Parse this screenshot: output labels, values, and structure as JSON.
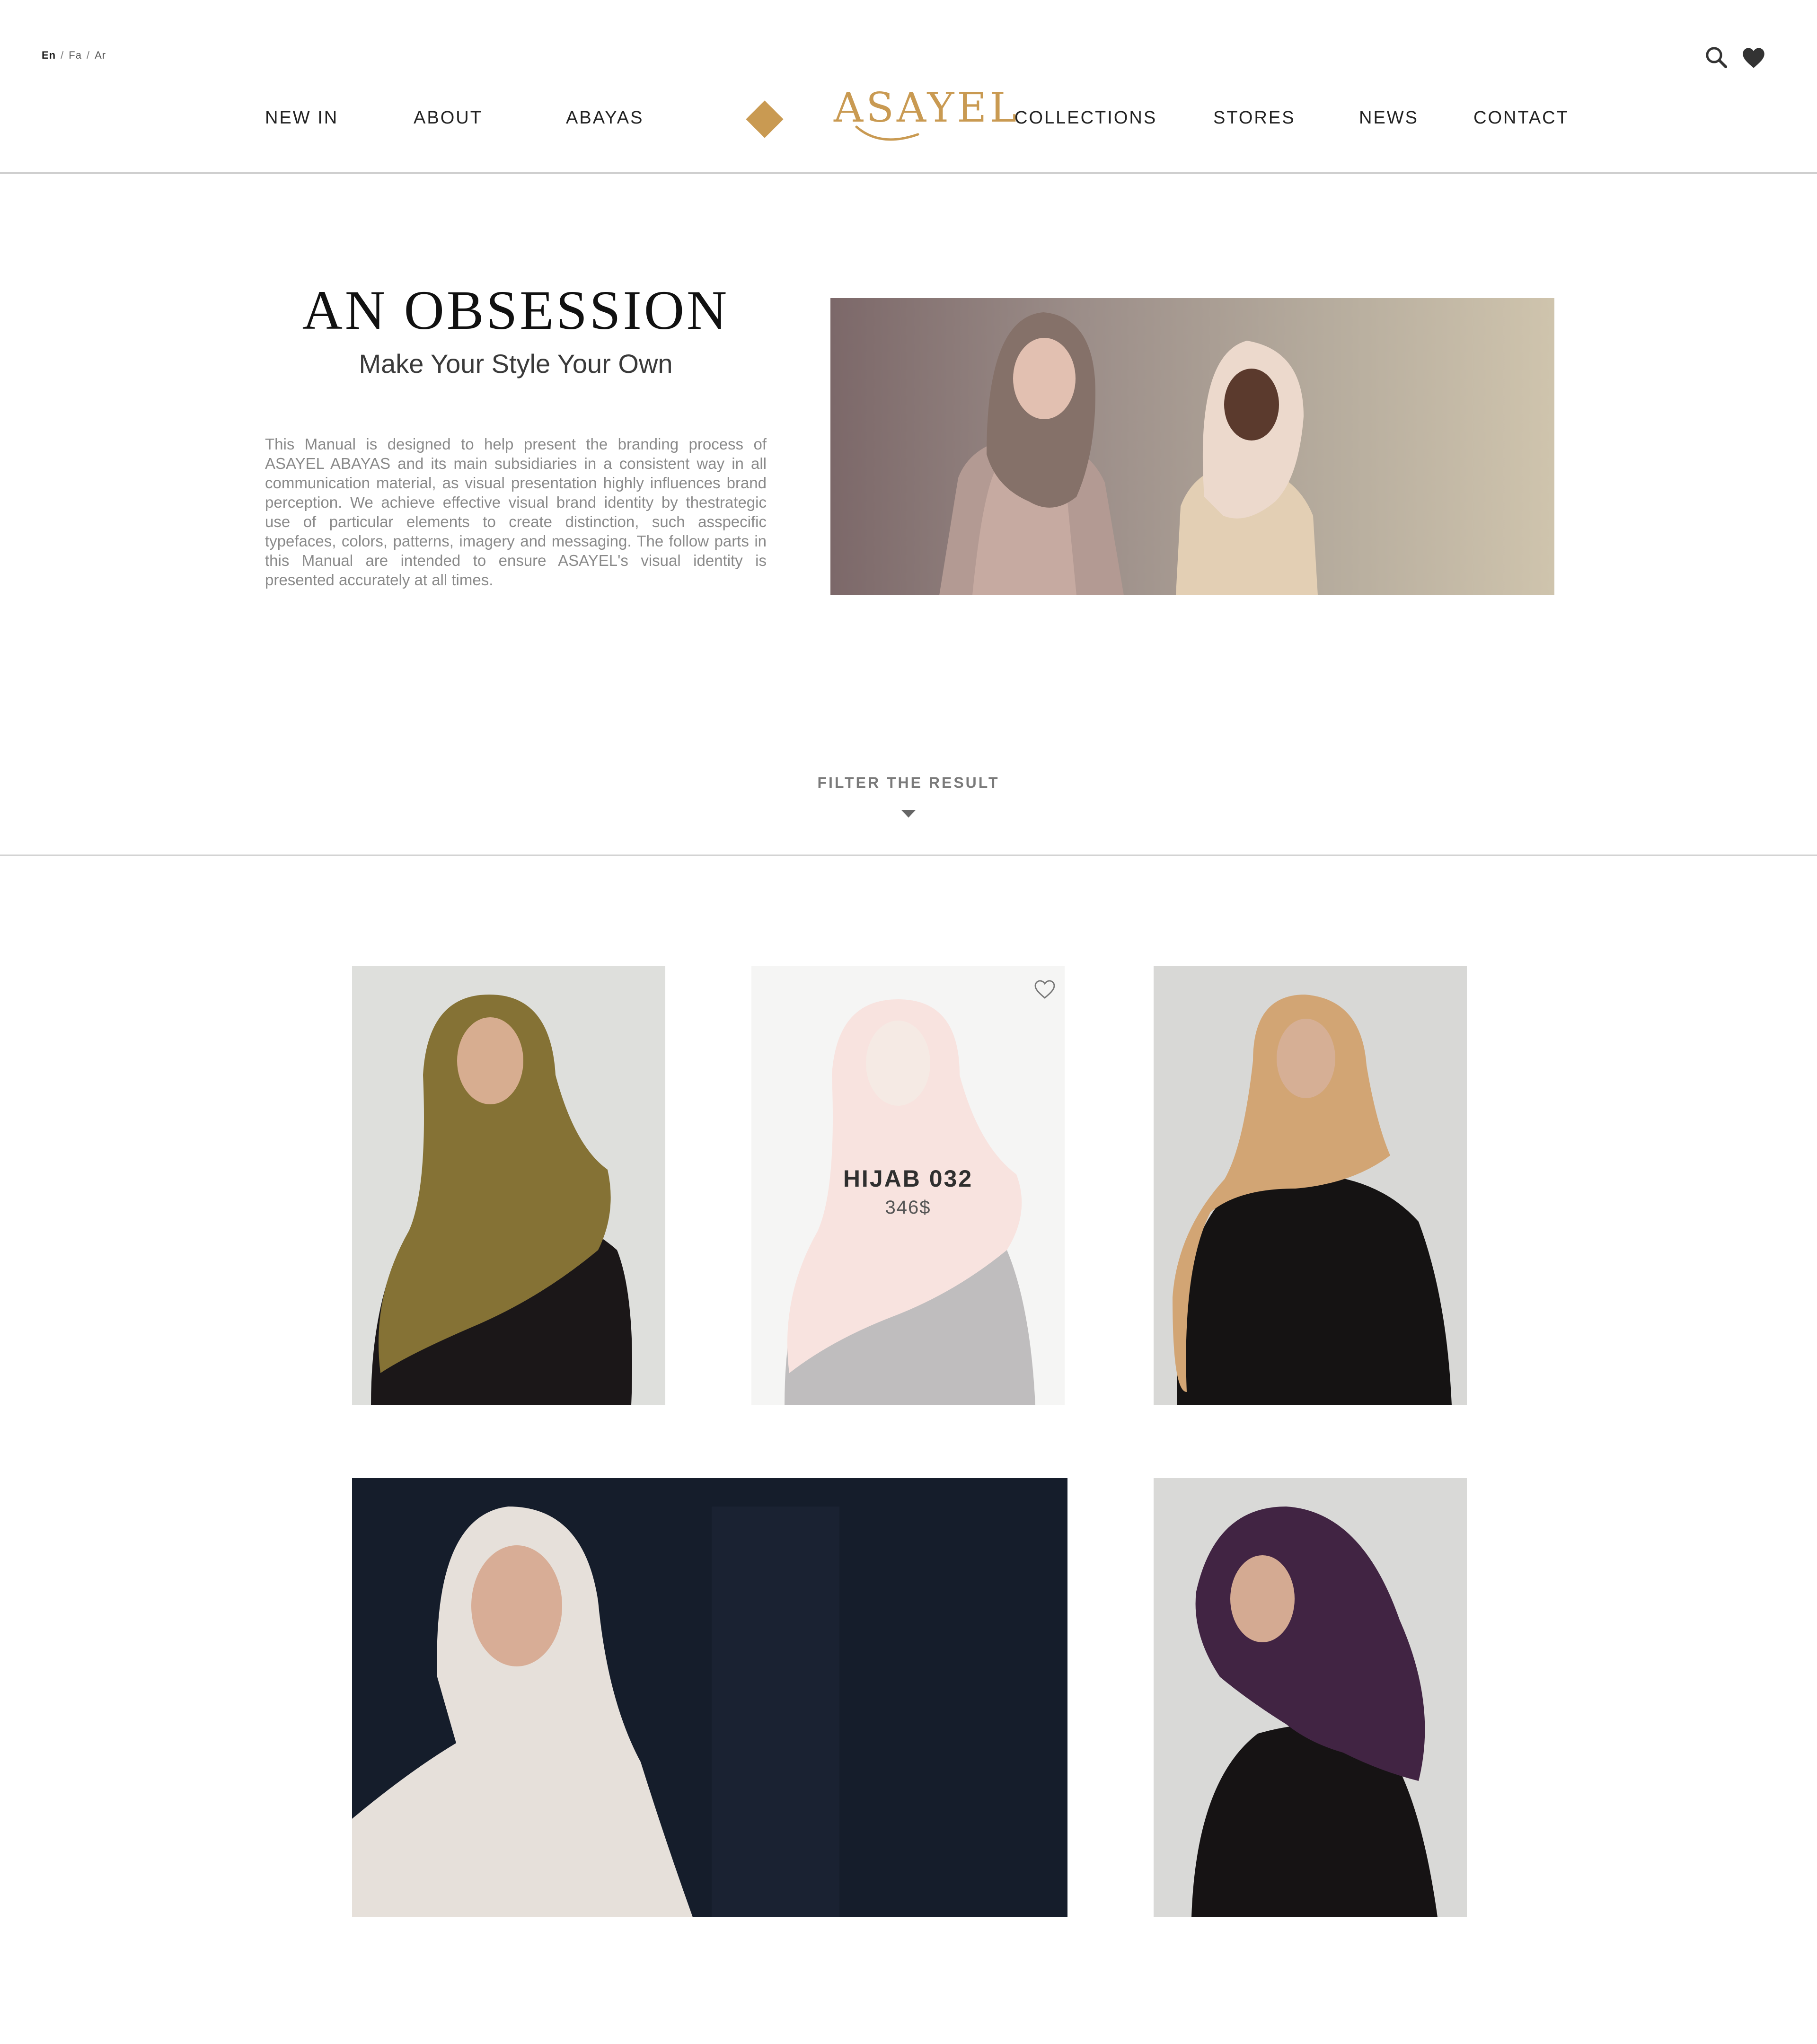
{
  "header": {
    "languages": [
      "En",
      "Fa",
      "Ar"
    ],
    "active_language": "En",
    "nav_left": [
      "NEW IN",
      "ABOUT",
      "ABAYAS"
    ],
    "nav_right": [
      "COLLECTIONS",
      "STORES",
      "NEWS",
      "CONTACT"
    ],
    "logo": "ASAYEL",
    "icons": [
      "search-icon",
      "heart-icon"
    ]
  },
  "intro": {
    "title": "AN OBSESSION",
    "subtitle": "Make Your Style Your Own",
    "body": "This Manual is designed to help present the branding process of ASAYEL ABAYAS and its main subsidiaries in a consistent way in all communication material, as visual presentation highly influences brand perception. We achieve effective visual brand identity by thestrategic use of particular elements to create distinction, such asspecific typefaces, colors,  patterns, imagery and messaging. The follow parts in this Manual are intended to ensure ASAYEL's visual identity is presented accurately at all times."
  },
  "filter": {
    "label": "FILTER THE RESULT",
    "icon": "caret-down-icon"
  },
  "products": {
    "hovered": {
      "name": "HIJAB 032",
      "price": "346$",
      "icon": "heart-outline-icon"
    }
  },
  "colors": {
    "brand_gold": "#c99a52",
    "text_dark": "#1f1f1f",
    "divider": "#d3d3d3",
    "dark_banner": "#151d2b"
  }
}
